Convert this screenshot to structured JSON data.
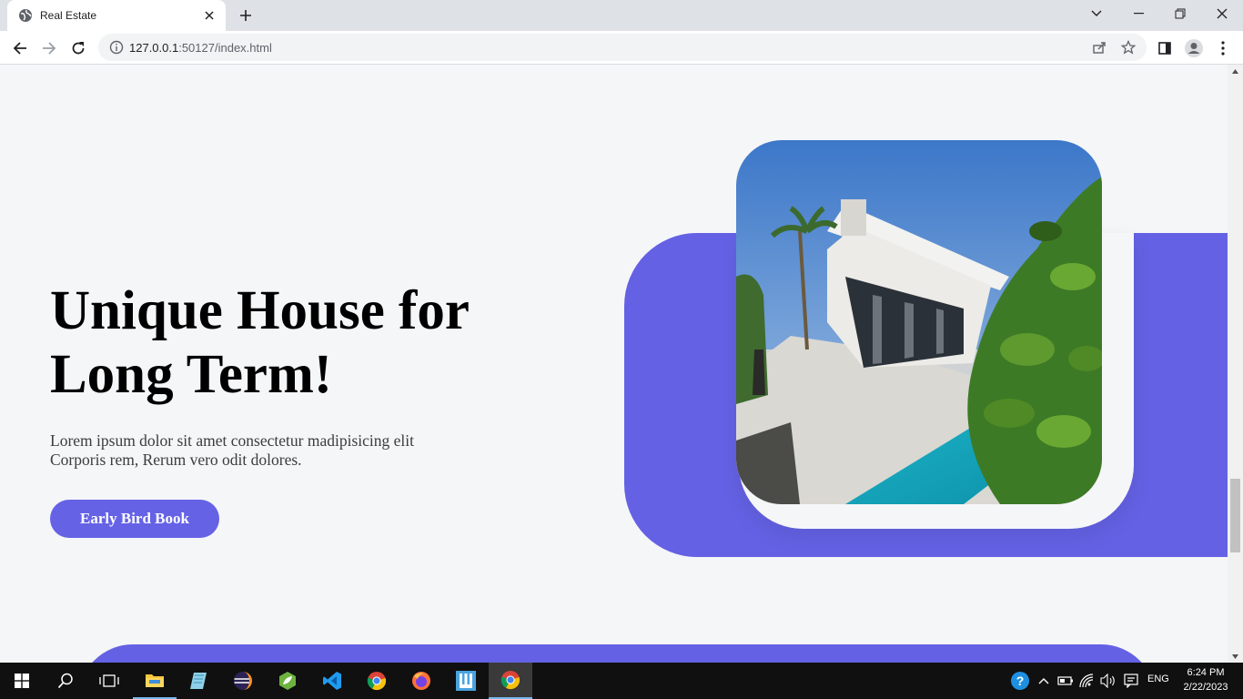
{
  "browser": {
    "tab_title": "Real Estate",
    "url_host": "127.0.0.1",
    "url_rest": ":50127/index.html"
  },
  "page": {
    "hero_title_line1": "Unique House for",
    "hero_title_line2": "Long Term!",
    "hero_text_line1": "Lorem ipsum dolor sit amet consectetur madipisicing elit",
    "hero_text_line2": "Corporis rem, Rerum vero odit dolores.",
    "hero_button": "Early Bird Book",
    "accent_color": "#6562e5"
  },
  "taskbar": {
    "language": "ENG",
    "time": "6:24 PM",
    "date": "2/22/2023",
    "apps": [
      "start-icon",
      "search-icon",
      "task-view-icon",
      "file-explorer-icon",
      "notepad-icon",
      "eclipse-icon",
      "spring-tool-icon",
      "vscode-icon",
      "chrome-icon",
      "firefox-icon",
      "app-icon",
      "chrome-icon"
    ]
  }
}
